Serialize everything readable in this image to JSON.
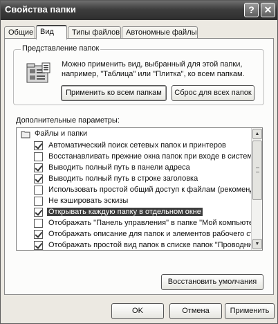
{
  "window": {
    "title": "Свойства папки"
  },
  "titlebar": {
    "help_glyph": "?",
    "close_glyph": "✕"
  },
  "tabs": [
    {
      "label": "Общие"
    },
    {
      "label": "Вид"
    },
    {
      "label": "Типы файлов"
    },
    {
      "label": "Автономные файлы"
    }
  ],
  "folder_view": {
    "legend": "Представление папок",
    "description": "Можно применить вид, выбранный для этой папки, например, \"Таблица\" или \"Плитка\", ко всем папкам.",
    "apply_all_label": "Применить ко всем папкам",
    "reset_all_label": "Сброс для всех папок"
  },
  "advanced": {
    "label": "Дополнительные параметры:",
    "items": [
      {
        "label": "Файлы и папки",
        "type": "folder"
      },
      {
        "label": "Автоматический поиск сетевых папок и принтеров",
        "checked": true
      },
      {
        "label": "Восстанавливать прежние окна папок при входе в систему",
        "checked": false
      },
      {
        "label": "Выводить полный путь в панели адреса",
        "checked": true
      },
      {
        "label": "Выводить полный путь в строке заголовка",
        "checked": true
      },
      {
        "label": "Использовать простой общий доступ к файлам (рекомендуется)",
        "checked": false
      },
      {
        "label": "Не кэшировать эскизы",
        "checked": false
      },
      {
        "label": "Открывать каждую папку в отдельном окне",
        "checked": true,
        "selected": true
      },
      {
        "label": "Отображать \"Панель управления\" в папке \"Мой компьютер\"",
        "checked": false
      },
      {
        "label": "Отображать описание для папок и элементов рабочего стола",
        "checked": true
      },
      {
        "label": "Отображать простой вид папок в списке папок \"Проводника\"",
        "checked": true
      }
    ]
  },
  "restore_defaults_label": "Восстановить умолчания",
  "buttons": {
    "ok": "OK",
    "cancel": "Отмена",
    "apply": "Применить"
  }
}
